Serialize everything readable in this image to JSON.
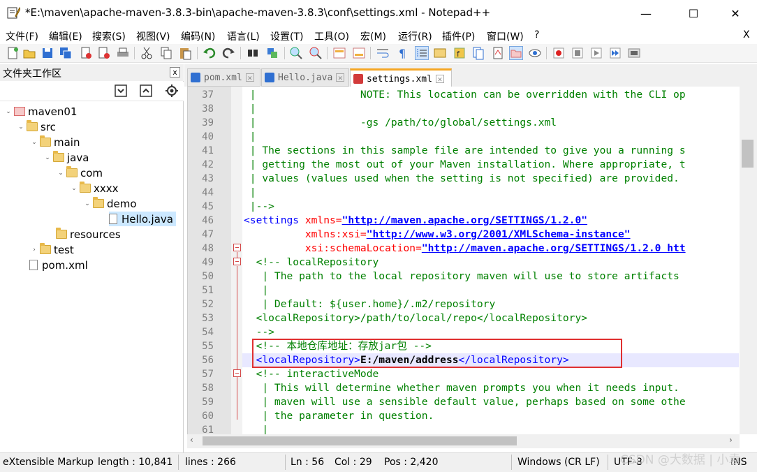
{
  "window": {
    "title": "*E:\\maven\\apache-maven-3.8.3-bin\\apache-maven-3.8.3\\conf\\settings.xml - Notepad++",
    "minimize": "—",
    "maximize": "☐",
    "close": "✕",
    "menu_close": "X"
  },
  "menu": [
    "文件(F)",
    "编辑(E)",
    "搜索(S)",
    "视图(V)",
    "编码(N)",
    "语言(L)",
    "设置(T)",
    "工具(O)",
    "宏(M)",
    "运行(R)",
    "插件(P)",
    "窗口(W)",
    "?"
  ],
  "sidebar": {
    "title": "文件夹工作区",
    "close": "x",
    "tree": [
      {
        "label": "maven01",
        "toggle": "⌄",
        "kind": "project"
      },
      {
        "label": "src",
        "toggle": "⌄",
        "kind": "folder"
      },
      {
        "label": "main",
        "toggle": "⌄",
        "kind": "folder"
      },
      {
        "label": "java",
        "toggle": "⌄",
        "kind": "folder"
      },
      {
        "label": "com",
        "toggle": "⌄",
        "kind": "folder"
      },
      {
        "label": "xxxx",
        "toggle": "⌄",
        "kind": "folder"
      },
      {
        "label": "demo",
        "toggle": "⌄",
        "kind": "folder"
      },
      {
        "label": "Hello.java",
        "toggle": "",
        "kind": "file",
        "selected": true
      },
      {
        "label": "resources",
        "toggle": "",
        "kind": "folder"
      },
      {
        "label": "test",
        "toggle": "›",
        "kind": "folder"
      },
      {
        "label": "pom.xml",
        "toggle": "",
        "kind": "file"
      }
    ]
  },
  "tabs": [
    {
      "label": "pom.xml",
      "active": false
    },
    {
      "label": "Hello.java",
      "active": false
    },
    {
      "label": "settings.xml",
      "active": true
    }
  ],
  "editor": {
    "line_numbers": [
      "37",
      "38",
      "39",
      "40",
      "41",
      "42",
      "43",
      "44",
      "45",
      "46",
      "47",
      "48",
      "49",
      "50",
      "51",
      "52",
      "53",
      "54",
      "55",
      "56",
      "57",
      "58",
      "59",
      "60",
      "61"
    ],
    "lines": [
      " |                 NOTE: This location can be overridden with the CLI op",
      " |",
      " |                 -gs /path/to/global/settings.xml",
      " |",
      " | The sections in this sample file are intended to give you a running s",
      " | getting the most out of your Maven installation. Where appropriate, t",
      " | values (values used when the setting is not specified) are provided.",
      " |",
      " |-->",
      "<settings",
      "          xmlns:xsi=",
      "          xsi:schemaLocation=",
      "  <!-- localRepository",
      "   | The path to the local repository maven will use to store artifacts",
      "   |",
      "   | Default: ${user.home}/.m2/repository",
      "  <localRepository>/path/to/local/repo</localRepository>",
      "  -->",
      "  <!-- 本地仓库地址：存放jar包 -->",
      "  <localRepository>",
      "  <!-- interactiveMode",
      "   | This will determine whether maven prompts you when it needs input.",
      "   | maven will use a sensible default value, perhaps based on some othe",
      "   | the parameter in question.",
      "   |"
    ],
    "settings_attr": " xmlns=",
    "settings_url": "\"http://maven.apache.org/SETTINGS/1.2.0\"",
    "xsi_url": "\"http://www.w3.org/2001/XMLSchema-instance\"",
    "schema_url": "\"http://maven.apache.org/SETTINGS/1.2.0 htt",
    "repo_value": "E:/maven/address",
    "repo_close": "</localRepository>"
  },
  "status": {
    "filetype": "eXtensible Markup",
    "length": "length : 10,841",
    "lines": "lines : 266",
    "ln": "Ln : 56",
    "col": "Col : 29",
    "pos": "Pos : 2,420",
    "eol": "Windows (CR LF)",
    "encoding": "UTF-8",
    "mode": "INS"
  },
  "watermark": "CSDN @大数据 | 小袁",
  "colors": {
    "comment": "#008000",
    "tag": "#0000ff",
    "attribute": "#ff0000",
    "value": "#8000ff",
    "highlight": "#e03030",
    "tab_accent": "#f5a623"
  }
}
